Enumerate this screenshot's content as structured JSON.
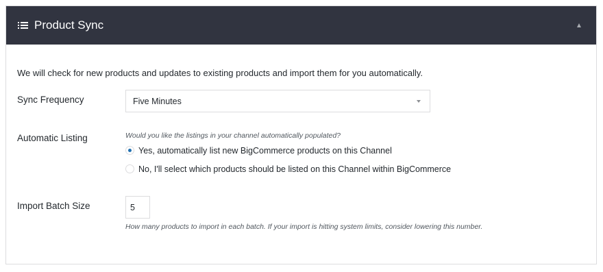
{
  "panel": {
    "title": "Product Sync",
    "header_icon": "list-icon",
    "collapse_icon": "collapse-arrow-up-icon",
    "header_color": "#313440"
  },
  "intro": "We will check for new products and updates to existing products and import them for you automatically.",
  "sync_frequency": {
    "label": "Sync Frequency",
    "selected": "Five Minutes"
  },
  "automatic_listing": {
    "label": "Automatic Listing",
    "help": "Would you like the listings in your channel automatically populated?",
    "options": [
      {
        "label": "Yes, automatically list new BigCommerce products on this Channel",
        "checked": true
      },
      {
        "label": "No, I'll select which products should be listed on this Channel within BigCommerce",
        "checked": false
      }
    ],
    "accent_color": "#2271b1"
  },
  "import_batch_size": {
    "label": "Import Batch Size",
    "value": "5",
    "help": "How many products to import in each batch. If your import is hitting system limits, consider lowering this number."
  }
}
